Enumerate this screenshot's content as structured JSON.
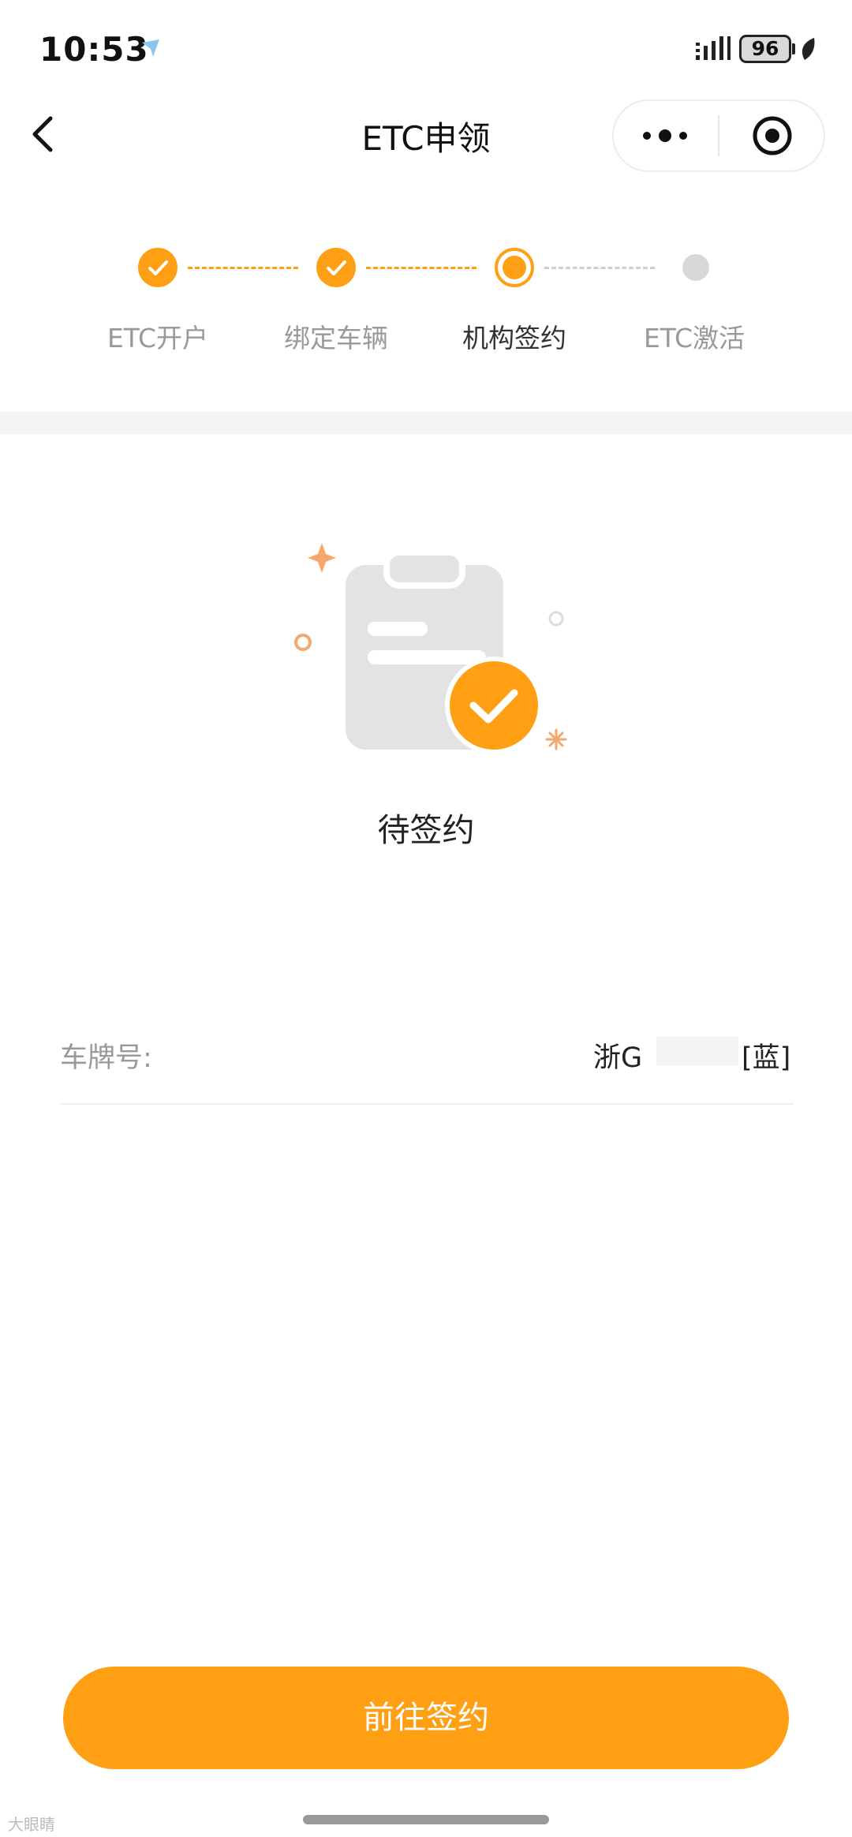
{
  "status_bar": {
    "time": "10:53",
    "battery": "96"
  },
  "nav": {
    "title": "ETC申领"
  },
  "steps": [
    {
      "label": "ETC开户",
      "state": "done"
    },
    {
      "label": "绑定车辆",
      "state": "done"
    },
    {
      "label": "机构签约",
      "state": "current"
    },
    {
      "label": "ETC激活",
      "state": "pending"
    }
  ],
  "status": {
    "title": "待签约"
  },
  "plate": {
    "label": "车牌号:",
    "prefix": "浙G",
    "color": "[蓝]"
  },
  "actions": {
    "primary_label": "前往签约"
  },
  "watermark": "大眼睛",
  "colors": {
    "accent": "#ff9f14",
    "pending": "#d8d8d8",
    "muted_text": "#999999"
  }
}
